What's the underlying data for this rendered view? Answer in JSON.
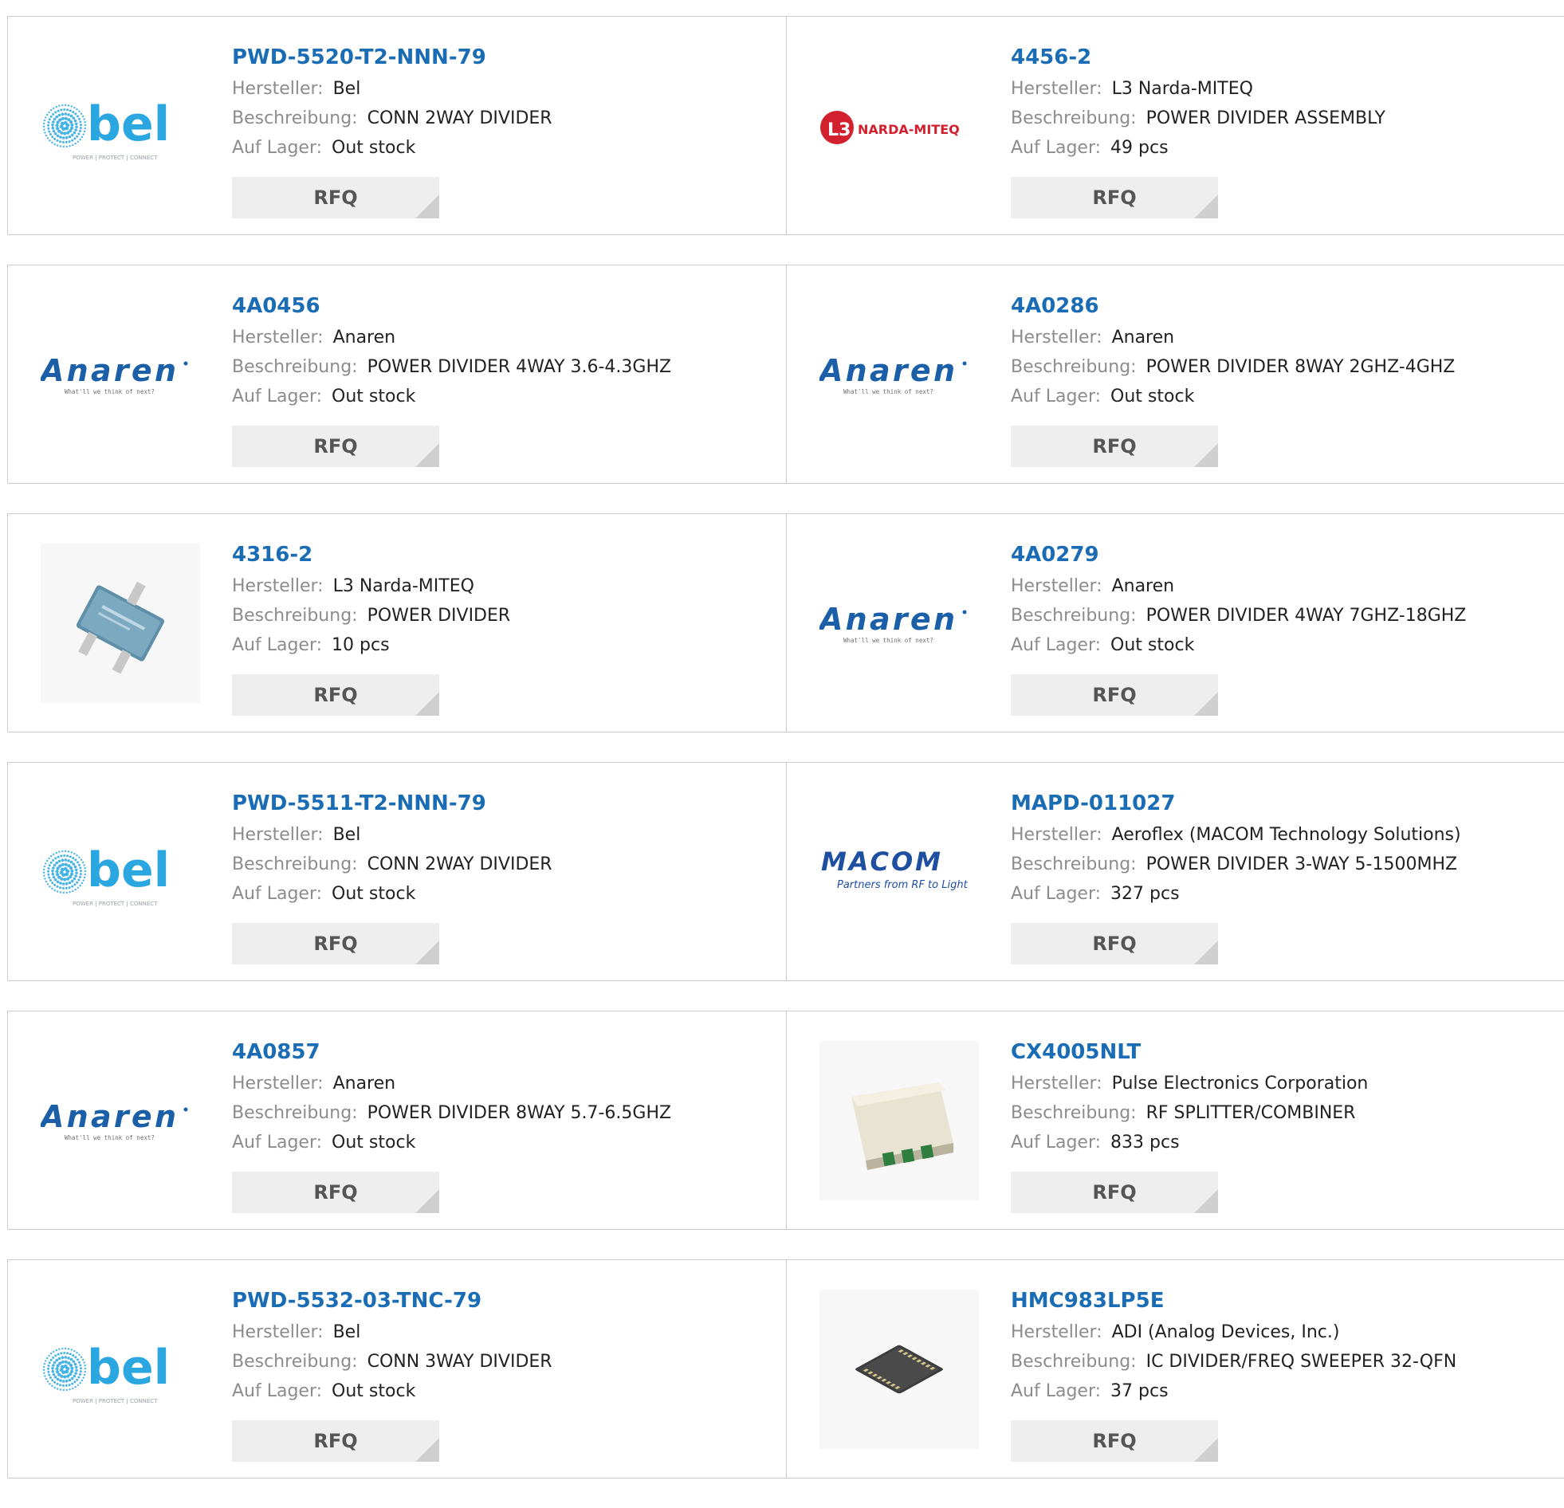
{
  "labels": {
    "manufacturer": "Hersteller:",
    "description": "Beschreibung:",
    "stock": "Auf Lager:",
    "rfq": "RFQ"
  },
  "logos": {
    "bel": {
      "text": "bel",
      "tagline": "POWER | PROTECT | CONNECT",
      "color": "#2aa7e0"
    },
    "anaren": {
      "text": "Anaren",
      "tagline": "What'll we think of next?",
      "color": "#1a5fa8"
    },
    "narda": {
      "mark": "L3",
      "text": "NARDA-MITEQ",
      "color": "#d3202f"
    },
    "macom": {
      "text": "MACOM",
      "tagline": "Partners from RF to Light",
      "color": "#1e4fa0"
    }
  },
  "products": [
    {
      "part": "PWD-5520-T2-NNN-79",
      "manufacturer": "Bel",
      "description": "CONN 2WAY DIVIDER",
      "stock": "Out stock",
      "logo": "bel"
    },
    {
      "part": "4456-2",
      "manufacturer": "L3 Narda-MITEQ",
      "description": "POWER DIVIDER ASSEMBLY",
      "stock": "49 pcs",
      "logo": "narda"
    },
    {
      "part": "4A0456",
      "manufacturer": "Anaren",
      "description": "POWER DIVIDER 4WAY 3.6-4.3GHZ",
      "stock": "Out stock",
      "logo": "anaren"
    },
    {
      "part": "4A0286",
      "manufacturer": "Anaren",
      "description": "POWER DIVIDER 8WAY 2GHZ-4GHZ",
      "stock": "Out stock",
      "logo": "anaren"
    },
    {
      "part": "4316-2",
      "manufacturer": "L3 Narda-MITEQ",
      "description": "POWER DIVIDER",
      "stock": "10 pcs",
      "logo": "divider-photo"
    },
    {
      "part": "4A0279",
      "manufacturer": "Anaren",
      "description": "POWER DIVIDER 4WAY 7GHZ-18GHZ",
      "stock": "Out stock",
      "logo": "anaren"
    },
    {
      "part": "PWD-5511-T2-NNN-79",
      "manufacturer": "Bel",
      "description": "CONN 2WAY DIVIDER",
      "stock": "Out stock",
      "logo": "bel"
    },
    {
      "part": "MAPD-011027",
      "manufacturer": "Aeroflex (MACOM Technology Solutions)",
      "description": "POWER DIVIDER 3-WAY 5-1500MHZ",
      "stock": "327 pcs",
      "logo": "macom"
    },
    {
      "part": "4A0857",
      "manufacturer": "Anaren",
      "description": "POWER DIVIDER 8WAY 5.7-6.5GHZ",
      "stock": "Out stock",
      "logo": "anaren"
    },
    {
      "part": "CX4005NLT",
      "manufacturer": "Pulse Electronics Corporation",
      "description": "RF SPLITTER/COMBINER",
      "stock": "833 pcs",
      "logo": "pulse-photo"
    },
    {
      "part": "PWD-5532-03-TNC-79",
      "manufacturer": "Bel",
      "description": "CONN 3WAY DIVIDER",
      "stock": "Out stock",
      "logo": "bel"
    },
    {
      "part": "HMC983LP5E",
      "manufacturer": "ADI (Analog Devices, Inc.)",
      "description": "IC DIVIDER/FREQ SWEEPER 32-QFN",
      "stock": "37 pcs",
      "logo": "qfn-photo"
    }
  ]
}
